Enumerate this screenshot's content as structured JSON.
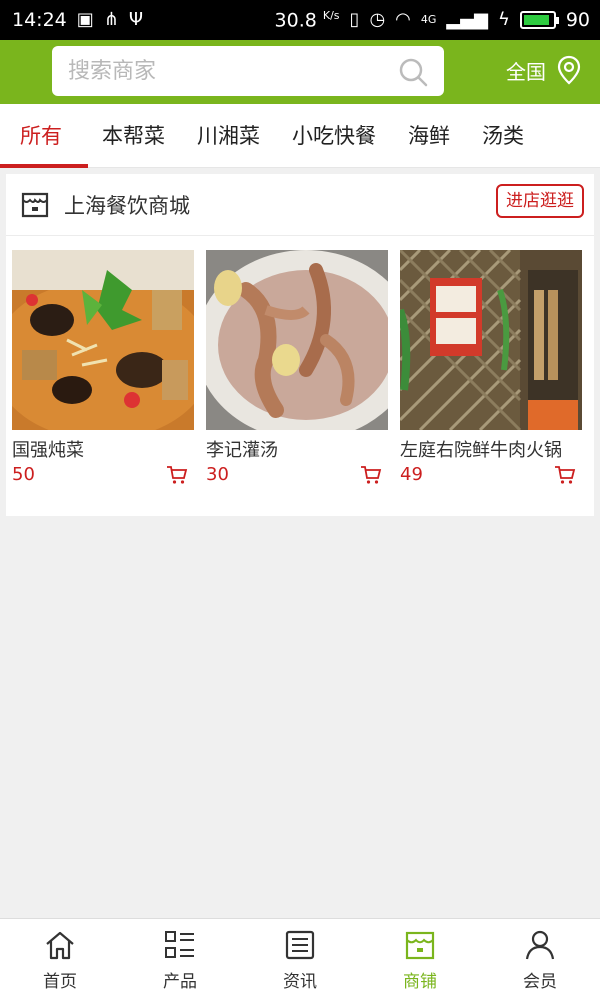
{
  "status_bar": {
    "time": "14:24",
    "network_speed": "30.8",
    "speed_unit": "K/s",
    "signal_label": "4G",
    "battery_level": "90"
  },
  "header": {
    "search_placeholder": "搜索商家",
    "region_label": "全国"
  },
  "tabs": [
    {
      "label": "所有",
      "active": true
    },
    {
      "label": "本帮菜"
    },
    {
      "label": "川湘菜"
    },
    {
      "label": "小吃快餐"
    },
    {
      "label": "海鲜"
    },
    {
      "label": "汤类"
    }
  ],
  "store": {
    "name": "上海餐饮商城",
    "visit_label": "进店逛逛",
    "products": [
      {
        "name": "国强炖菜",
        "price": "50"
      },
      {
        "name": "李记灌汤",
        "price": "30"
      },
      {
        "name": "左庭右院鲜牛肉火锅",
        "price": "49"
      }
    ]
  },
  "bottom_nav": [
    {
      "label": "首页",
      "icon": "home-icon"
    },
    {
      "label": "产品",
      "icon": "list-icon"
    },
    {
      "label": "资讯",
      "icon": "news-icon"
    },
    {
      "label": "商铺",
      "icon": "shop-icon",
      "active": true
    },
    {
      "label": "会员",
      "icon": "user-icon"
    }
  ],
  "colors": {
    "brand_green": "#7ab51d",
    "accent_red": "#cc1f1f"
  }
}
